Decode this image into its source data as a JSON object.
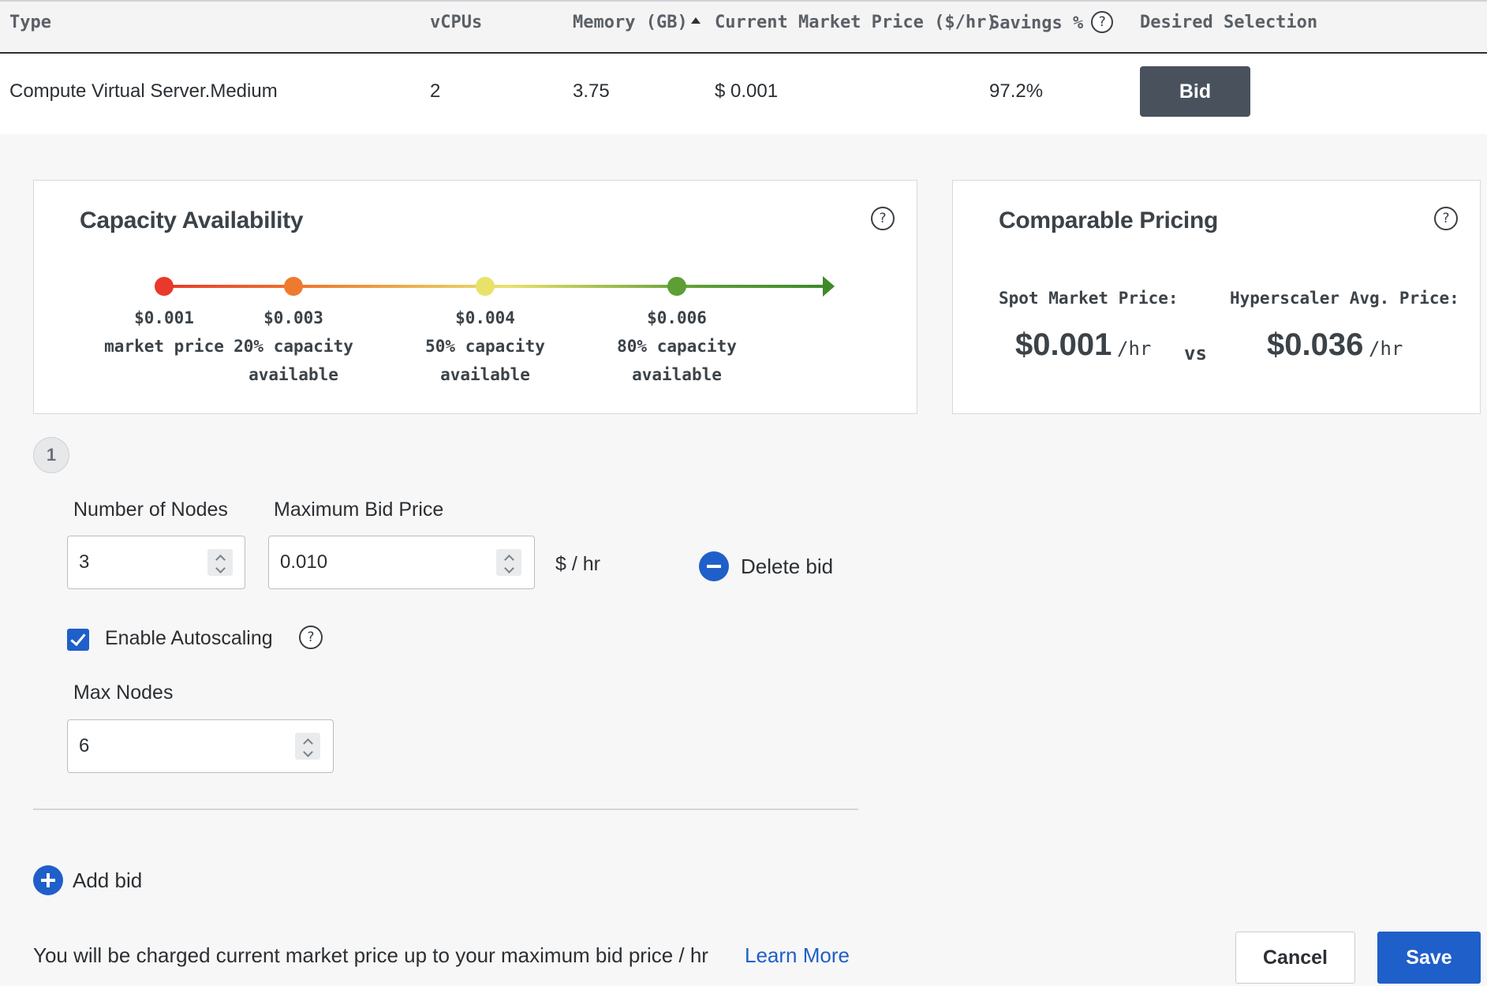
{
  "table": {
    "headers": {
      "type": "Type",
      "vcpus": "vCPUs",
      "memory": "Memory (GB)",
      "price": "Current Market Price ($/hr)",
      "savings": "Savings %",
      "selection": "Desired Selection"
    },
    "row": {
      "type": "Compute Virtual Server.Medium",
      "vcpus": "2",
      "memory": "3.75",
      "price": "$ 0.001",
      "savings": "97.2%",
      "action": "Bid"
    }
  },
  "capacity": {
    "title": "Capacity Availability",
    "points": [
      {
        "price": "$0.001",
        "line1": "market price",
        "line2": "",
        "color": "#e8392b"
      },
      {
        "price": "$0.003",
        "line1": "20% capacity",
        "line2": "available",
        "color": "#ef7a2e"
      },
      {
        "price": "$0.004",
        "line1": "50% capacity",
        "line2": "available",
        "color": "#e9e26a"
      },
      {
        "price": "$0.006",
        "line1": "80% capacity",
        "line2": "available",
        "color": "#5d9e35"
      }
    ],
    "arrow_color": "#3e8a2a"
  },
  "pricing": {
    "title": "Comparable Pricing",
    "spot_label": "Spot Market Price:",
    "spot_price": "$0.001",
    "hyper_label": "Hyperscaler Avg. Price:",
    "hyper_price": "$0.036",
    "unit": "/hr",
    "vs": "vs"
  },
  "bid": {
    "step": "1",
    "nodes_label": "Number of Nodes",
    "nodes_value": "3",
    "max_price_label": "Maximum Bid Price",
    "max_price_value": "0.010",
    "price_unit": "$ / hr",
    "delete_label": "Delete bid",
    "autoscaling_label": "Enable Autoscaling",
    "autoscaling_checked": true,
    "max_nodes_label": "Max Nodes",
    "max_nodes_value": "6"
  },
  "add_bid_label": "Add bid",
  "footer": {
    "note": "You will be charged current market price up to your maximum bid price / hr",
    "learn_more": "Learn More",
    "cancel": "Cancel",
    "save": "Save"
  },
  "colors": {
    "accent": "#1f5fc9",
    "bid_button": "#49525c"
  }
}
